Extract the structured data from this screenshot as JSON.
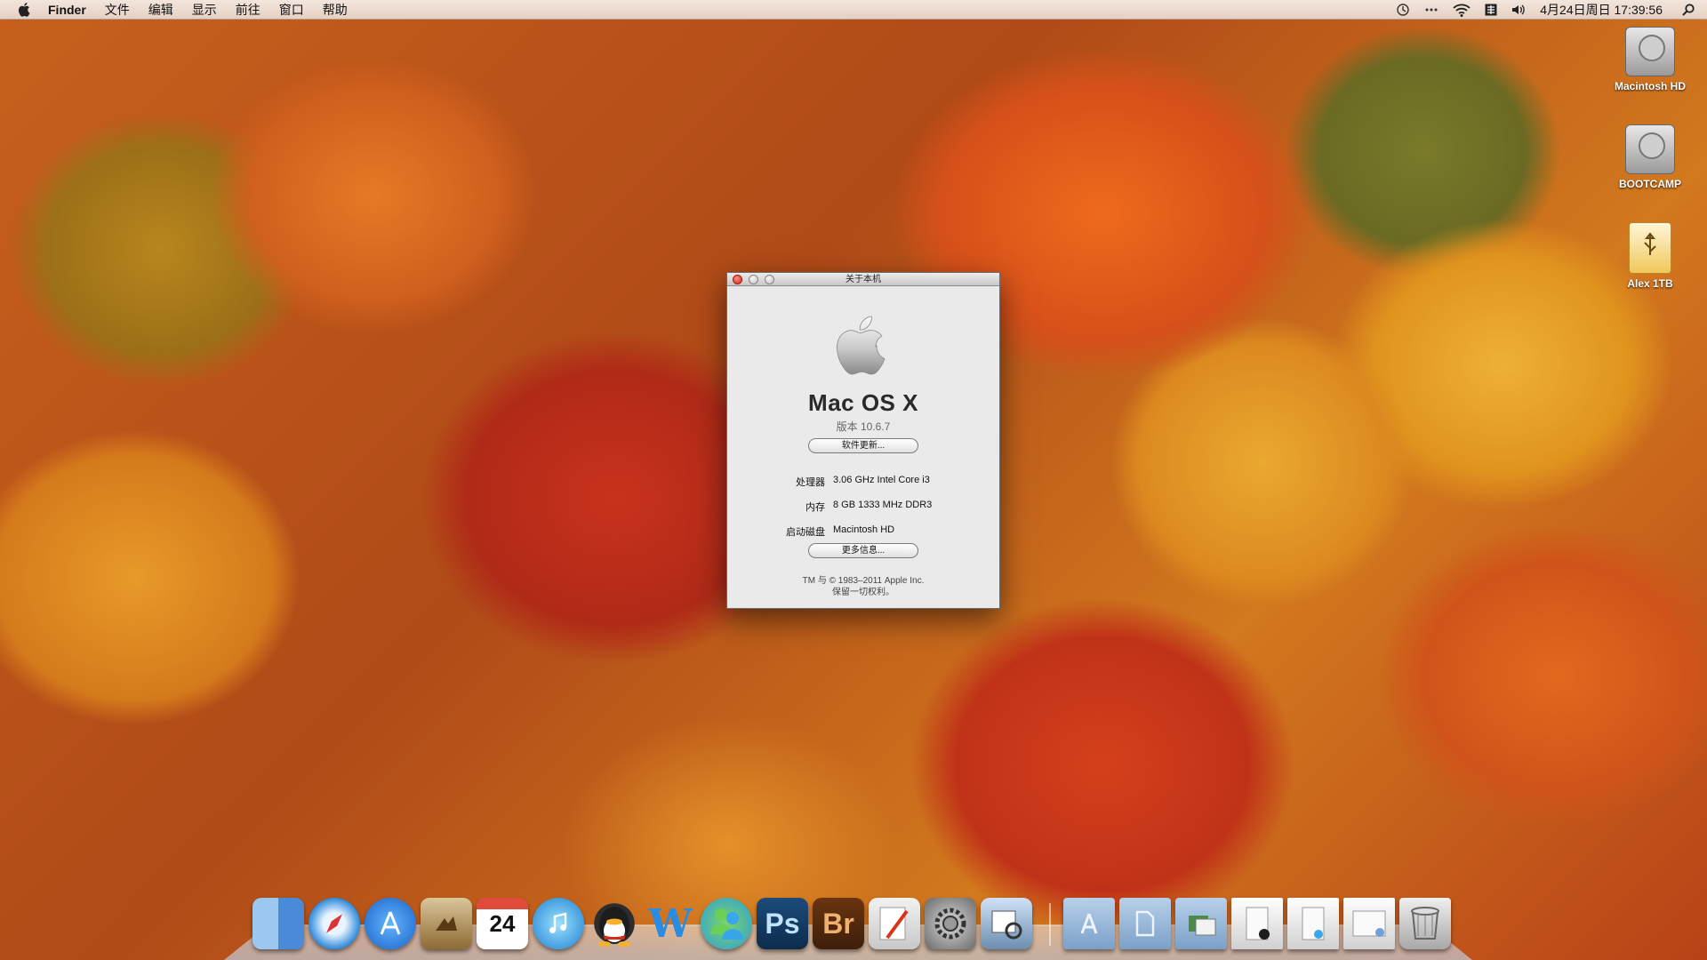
{
  "menubar": {
    "app_name": "Finder",
    "items": [
      "文件",
      "编辑",
      "显示",
      "前往",
      "窗口",
      "帮助"
    ],
    "clock": "4月24日周日  17:39:56"
  },
  "desktop_icons": [
    {
      "label": "Macintosh HD"
    },
    {
      "label": "BOOTCAMP"
    },
    {
      "label": "Alex 1TB"
    }
  ],
  "about_window": {
    "title": "关于本机",
    "os_name": "Mac OS X",
    "version": "版本 10.6.7",
    "software_update_button": "软件更新...",
    "processor_label": "处理器",
    "processor_value": "3.06 GHz Intel Core i3",
    "memory_label": "内存",
    "memory_value": "8 GB 1333 MHz DDR3",
    "startup_disk_label": "启动磁盘",
    "startup_disk_value": "Macintosh HD",
    "more_info_button": "更多信息...",
    "copyright_line1": "TM 与 © 1983–2011 Apple Inc.",
    "copyright_line2": "保留一切权利。"
  },
  "dock": {
    "ical_date": "24",
    "word_letter": "W",
    "ps_label": "Ps",
    "br_label": "Br"
  }
}
